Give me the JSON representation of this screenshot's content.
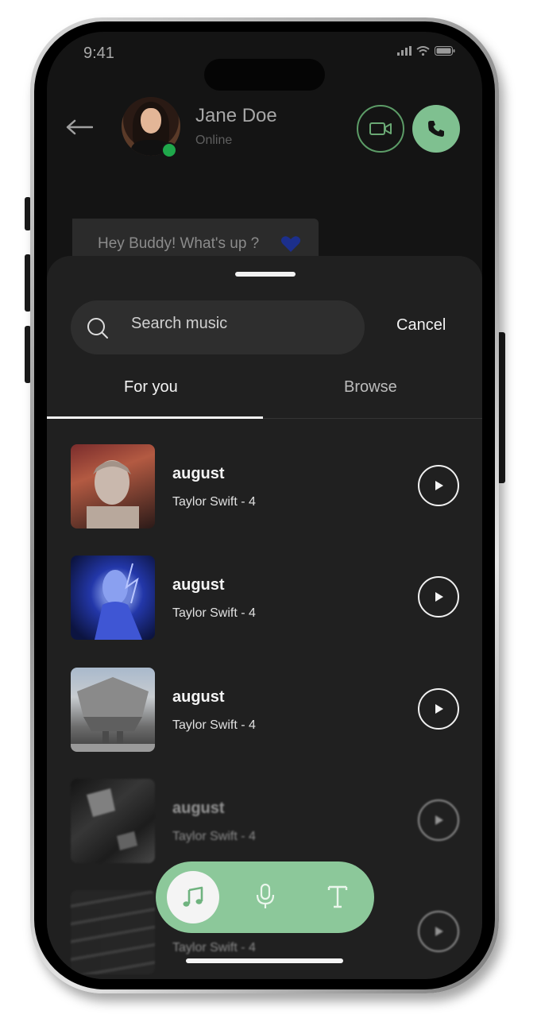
{
  "status_bar": {
    "time": "9:41"
  },
  "header": {
    "contact_name": "Jane Doe",
    "contact_status": "Online"
  },
  "chat": {
    "message": "Hey Buddy! What's up ?"
  },
  "sheet": {
    "search_placeholder": "Search music",
    "cancel_label": "Cancel",
    "tabs": [
      {
        "label": "For you",
        "active": true
      },
      {
        "label": "Browse",
        "active": false
      }
    ],
    "songs": [
      {
        "title": "august",
        "artist_line": "Taylor  Swift - 4"
      },
      {
        "title": "august",
        "artist_line": "Taylor  Swift - 4"
      },
      {
        "title": "august",
        "artist_line": "Taylor  Swift - 4"
      },
      {
        "title": "august",
        "artist_line": "Taylor  Swift - 4"
      },
      {
        "title": "",
        "artist_line": "Taylor  Swift - 4"
      }
    ]
  },
  "toolbar": {
    "items": [
      "music-note-icon",
      "microphone-icon",
      "text-icon"
    ],
    "active": "music-note-icon"
  },
  "colors": {
    "accent_green": "#8cc89a",
    "online_green": "#1fa84b",
    "screen_bg": "#141414",
    "sheet_bg": "#202020"
  }
}
